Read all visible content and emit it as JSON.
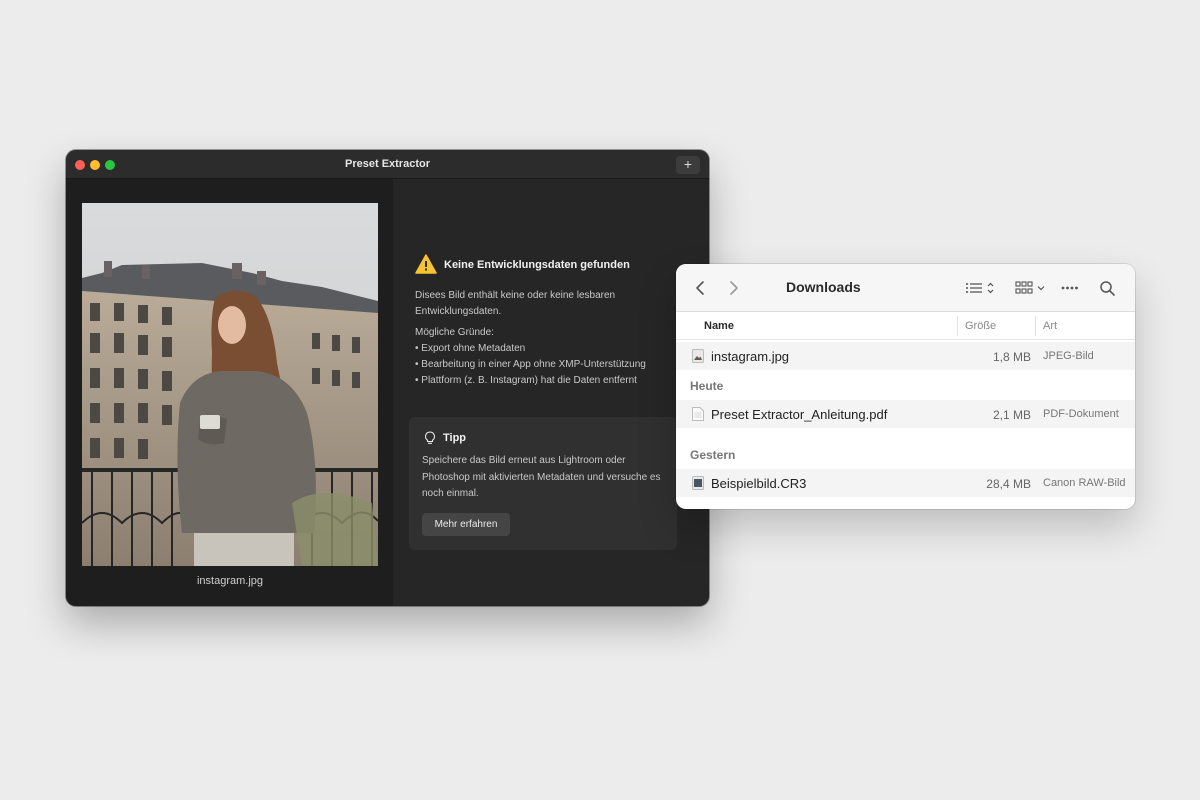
{
  "app_window": {
    "title": "Preset Extractor",
    "add_button": "+",
    "image_filename": "instagram.jpg",
    "warning": {
      "title": "Keine Entwicklungsdaten gefunden",
      "description": "Disees Bild enthält keine oder keine lesbaren Entwicklungsdaten."
    },
    "reasons": {
      "title": "Mögliche Gründe:",
      "items": [
        "• Export ohne Metadaten",
        "• Bearbeitung in einer App ohne XMP-Unterstützung",
        "• Plattform (z. B. Instagram) hat die Daten entfernt"
      ]
    },
    "tip": {
      "title": "Tipp",
      "text": "Speichere das Bild erneut aus Lightroom oder Photoshop mit aktivierten Metadaten und versuche es noch einmal.",
      "button_label": "Mehr erfahren"
    }
  },
  "finder": {
    "title": "Downloads",
    "columns": {
      "name": "Name",
      "size": "Größe",
      "kind": "Art"
    },
    "pinned_file": {
      "name": "instagram.jpg",
      "size": "1,8 MB",
      "kind": "JPEG-Bild",
      "icon": "jpeg-file-icon"
    },
    "groups": [
      {
        "label": "Heute",
        "files": [
          {
            "name": "Preset Extractor_Anleitung.pdf",
            "size": "2,1 MB",
            "kind": "PDF-Dokument",
            "icon": "pdf-file-icon"
          }
        ]
      },
      {
        "label": "Gestern",
        "files": [
          {
            "name": "Beispielbild.CR3",
            "size": "28,4 MB",
            "kind": "Canon RAW-Bild",
            "icon": "raw-file-icon"
          }
        ]
      }
    ]
  },
  "colors": {
    "window_bg": "#232323",
    "warning_yellow": "#f7c332",
    "finder_bg": "#ffffff",
    "desktop_bg": "#ececec"
  }
}
